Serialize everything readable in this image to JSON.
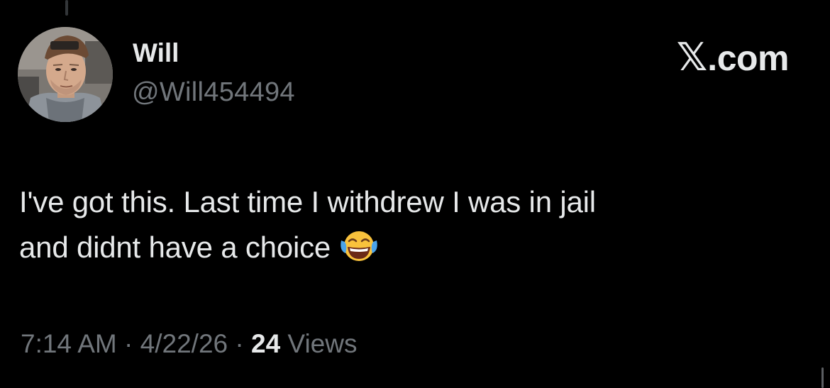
{
  "author": {
    "display_name": "Will",
    "handle": "@Will454494",
    "avatar_icon": "profile-photo"
  },
  "brand": {
    "logo_glyph": "𝕏",
    "domain": ".com"
  },
  "tweet": {
    "line1": "I've got this. Last time I withdrew I was in jail",
    "line2": "and didnt have a choice",
    "emoji_icon": "face-with-tears-of-joy-icon"
  },
  "meta": {
    "time": "7:14 AM",
    "separator": " · ",
    "date": "4/22/26",
    "views_count": "24",
    "views_label": " Views"
  },
  "colors": {
    "background": "#000000",
    "primary_text": "#e7e9ea",
    "secondary_text": "#71767b"
  }
}
